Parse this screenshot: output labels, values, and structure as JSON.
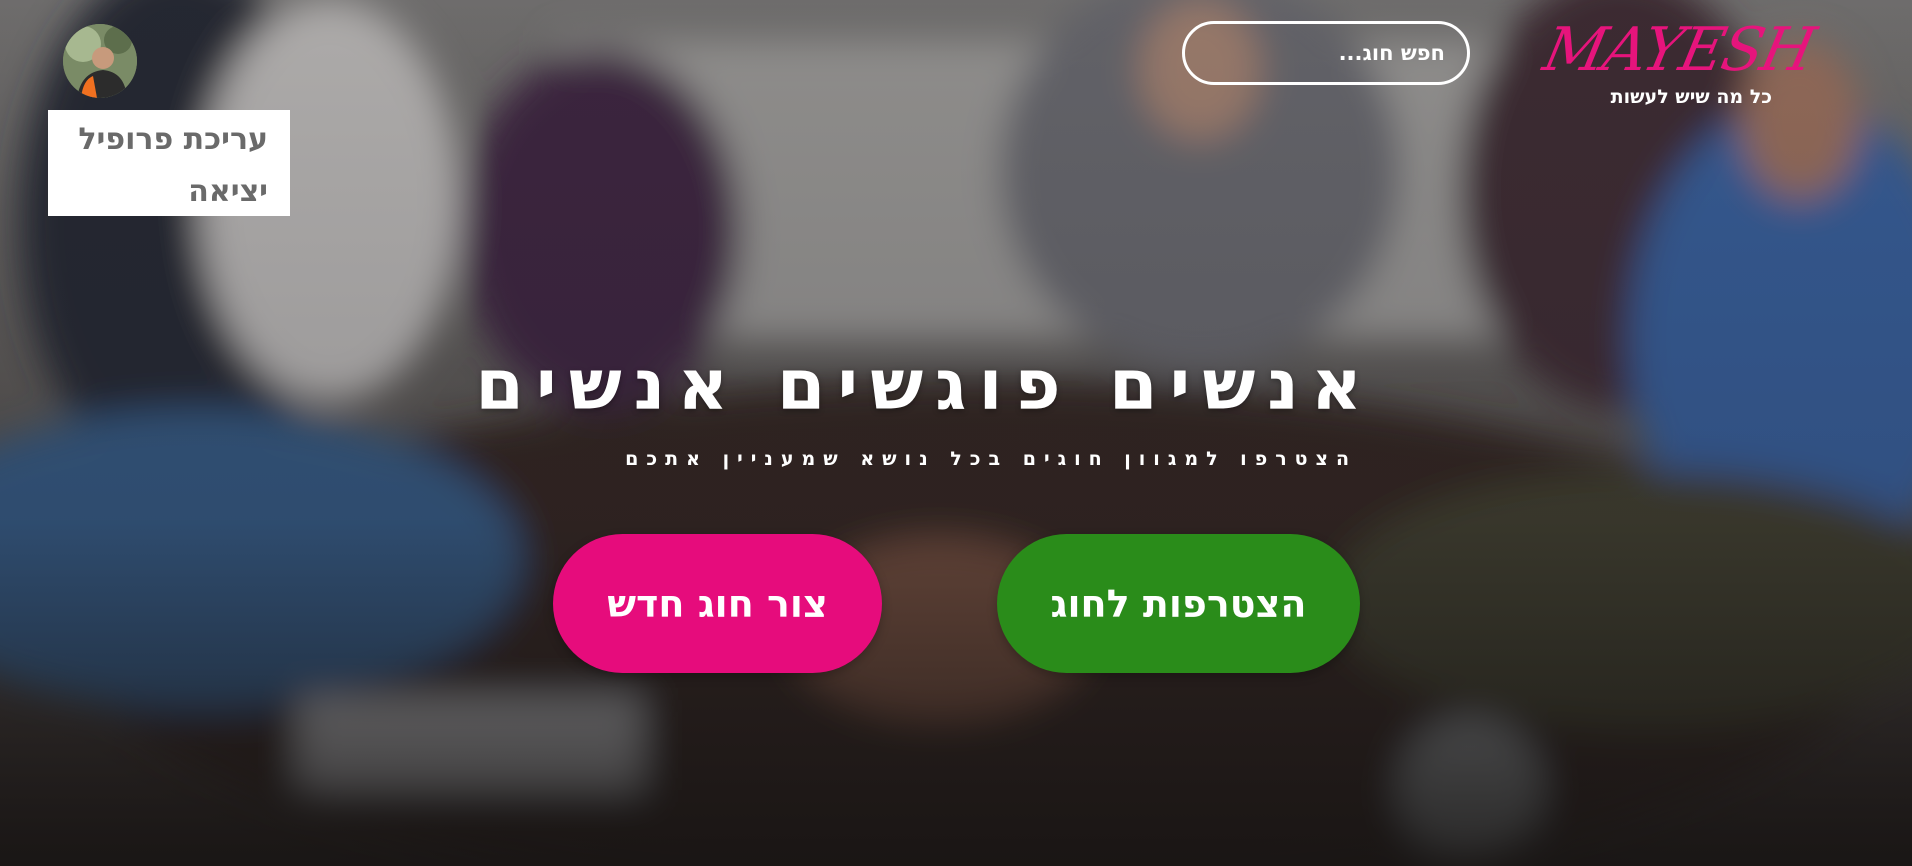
{
  "header": {
    "logo_text": "MAYESH",
    "logo_tagline": "כל מה שיש לעשות",
    "search": {
      "placeholder": "חפש חוג..."
    },
    "avatar_icon": "user-avatar-photo",
    "user_menu": {
      "items": [
        {
          "label": "עריכת פרופיל"
        },
        {
          "label": "יציאה"
        }
      ]
    }
  },
  "hero": {
    "title": "אנשים פוגשים אנשים",
    "subtitle": "הצטרפו למגוון חוגים בכל נושא שמעניין אתכם",
    "buttons": {
      "join_label": "הצטרפות לחוג",
      "create_label": "צור חוג חדש"
    }
  },
  "colors": {
    "brand_pink": "#e60c7c",
    "join_green": "#2a8c1a",
    "menu_text": "#6a6a6a"
  }
}
